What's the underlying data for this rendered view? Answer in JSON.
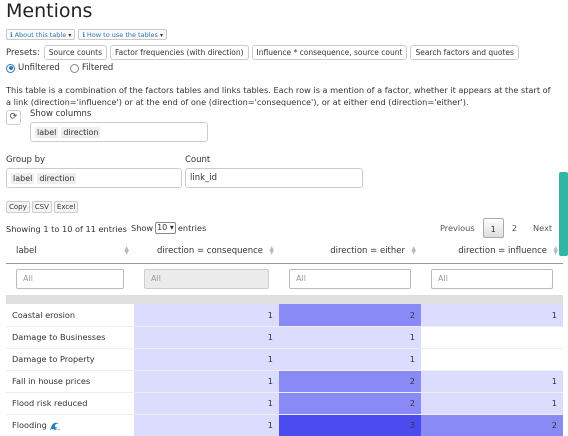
{
  "title": "Mentions",
  "info_buttons": [
    {
      "label": "About this table"
    },
    {
      "label": "How to use the tables"
    }
  ],
  "presets": {
    "label": "Presets:",
    "buttons": [
      "Source counts",
      "Factor frequencies (with direction)",
      "Influence * consequence, source count",
      "Search factors and quotes"
    ]
  },
  "radio": {
    "unfiltered": "Unfiltered",
    "filtered": "Filtered",
    "selected": "Unfiltered"
  },
  "description": "This table is a combination of the factors tables and links tables. Each row is a mention of a factor, whether it appears at the start of a link (direction='influence') or at the end of one (direction='consequence'), or at either end (direction='either').",
  "show_columns": {
    "label": "Show columns",
    "tags": [
      "label",
      "direction"
    ]
  },
  "group_by": {
    "label": "Group by",
    "tags": [
      "label",
      "direction"
    ]
  },
  "count": {
    "label": "Count",
    "value": "link_id"
  },
  "export_buttons": [
    "Copy",
    "CSV",
    "Excel"
  ],
  "showing": "Showing 1 to 10 of 11 entries",
  "length": {
    "prefix": "Show",
    "value": "10",
    "suffix": "entries"
  },
  "pagination": {
    "previous": "Previous",
    "pages": [
      "1",
      "2"
    ],
    "current": "1",
    "next": "Next"
  },
  "table": {
    "columns": [
      "label",
      "direction = consequence",
      "direction = either",
      "direction = influence"
    ],
    "filter_placeholder": "All",
    "rows": [
      {
        "label": "Coastal erosion",
        "consequence": "1",
        "either": "2",
        "influence": "1",
        "icon": ""
      },
      {
        "label": "Damage to Businesses",
        "consequence": "1",
        "either": "1",
        "influence": "",
        "icon": ""
      },
      {
        "label": "Damage to Property",
        "consequence": "1",
        "either": "1",
        "influence": "",
        "icon": ""
      },
      {
        "label": "Fall in house prices",
        "consequence": "1",
        "either": "2",
        "influence": "1",
        "icon": ""
      },
      {
        "label": "Flood risk reduced",
        "consequence": "1",
        "either": "2",
        "influence": "1",
        "icon": ""
      },
      {
        "label": "Flooding",
        "consequence": "1",
        "either": "3",
        "influence": "2",
        "icon": "wave-icon"
      }
    ]
  },
  "colors": {
    "level1": "#dcdcff",
    "level2": "#8a8af7",
    "level3": "#4b4bef",
    "accent": "#2a7ab8",
    "scrollbar": "#31b6a6"
  }
}
